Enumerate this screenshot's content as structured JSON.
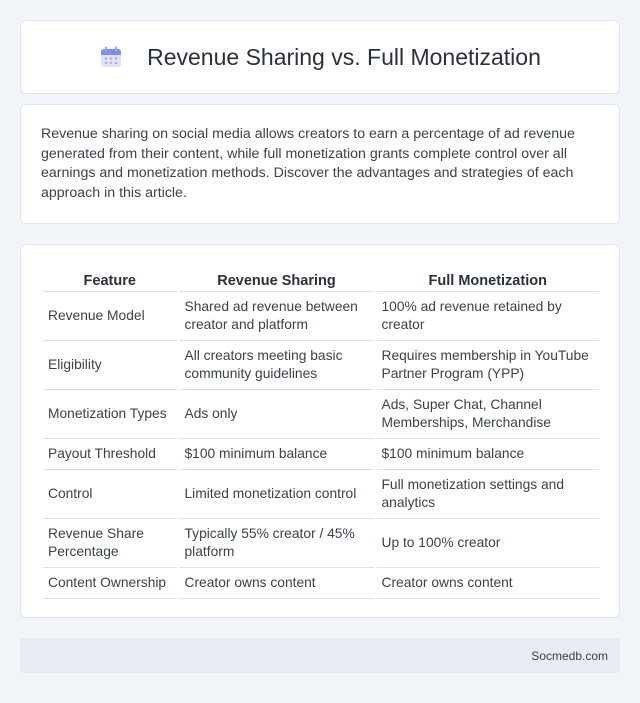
{
  "header": {
    "title": "Revenue Sharing vs. Full Monetization",
    "icon": "calendar-icon"
  },
  "intro": {
    "text": "Revenue sharing on social media allows creators to earn a percentage of ad revenue generated from their content, while full monetization grants complete control over all earnings and monetization methods. Discover the advantages and strategies of each approach in this article."
  },
  "table": {
    "headers": [
      "Feature",
      "Revenue Sharing",
      "Full Monetization"
    ],
    "rows": [
      [
        "Revenue Model",
        "Shared ad revenue between creator and platform",
        "100% ad revenue retained by creator"
      ],
      [
        "Eligibility",
        "All creators meeting basic community guidelines",
        "Requires membership in YouTube Partner Program (YPP)"
      ],
      [
        "Monetization Types",
        "Ads only",
        "Ads, Super Chat, Channel Memberships, Merchandise"
      ],
      [
        "Payout Threshold",
        "$100 minimum balance",
        "$100 minimum balance"
      ],
      [
        "Control",
        "Limited monetization control",
        "Full monetization settings and analytics"
      ],
      [
        "Revenue Share Percentage",
        "Typically 55% creator / 45% platform",
        "Up to 100% creator"
      ],
      [
        "Content Ownership",
        "Creator owns content",
        "Creator owns content"
      ]
    ]
  },
  "footer": {
    "site": "Socmedb.com"
  }
}
